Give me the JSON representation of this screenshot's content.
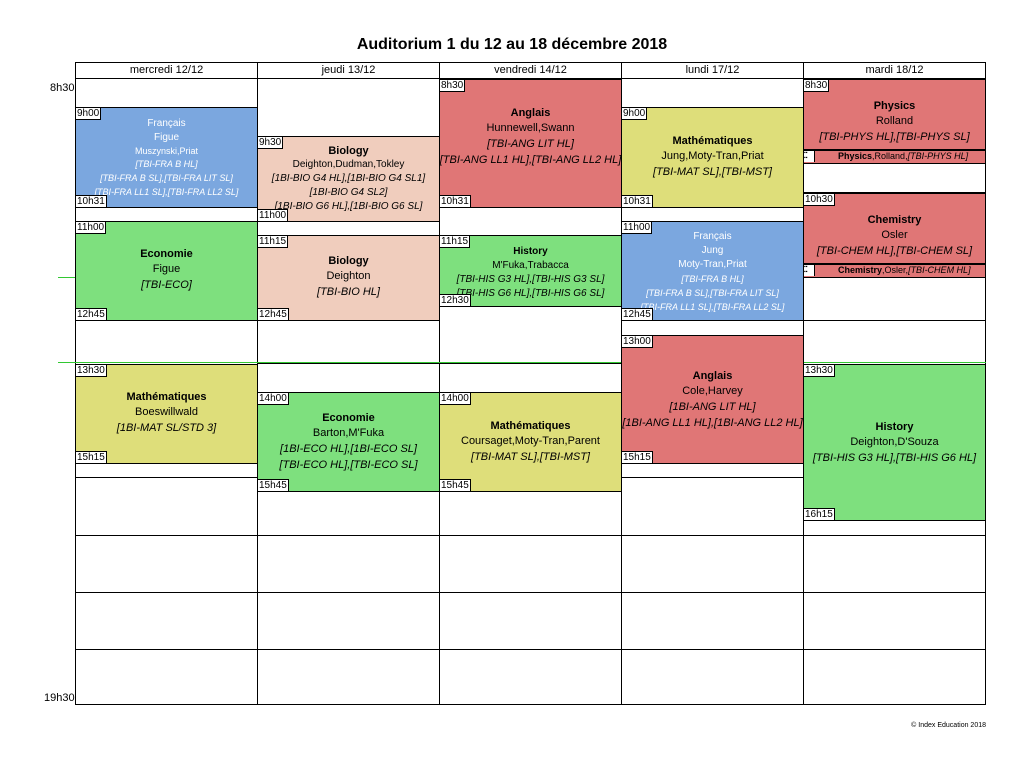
{
  "title": "Auditorium 1 du 12 au 18 décembre 2018",
  "footer": "© Index Education 2018",
  "time_axis": {
    "start": "8h30",
    "end": "19h30"
  },
  "days": [
    {
      "label": "mercredi 12/12"
    },
    {
      "label": "jeudi 13/12"
    },
    {
      "label": "vendredi 14/12"
    },
    {
      "label": "lundi 17/12"
    },
    {
      "label": "mardi 18/12"
    }
  ],
  "events": [
    {
      "day": 0,
      "start": "9h00",
      "end": "10h31",
      "subject": "Français",
      "teachers": "Figue",
      "extra": "Muszynski,Priat",
      "groups": [
        "[TBI-FRA B HL]",
        "[TBI-FRA B SL],[TBI-FRA LIT SL]",
        "[TBI-FRA LL1 SL],[TBI-FRA LL2 SL]"
      ],
      "color": "#7ba7df"
    },
    {
      "day": 0,
      "start": "11h00",
      "end": "12h45",
      "subject": "Economie",
      "teachers": "Figue",
      "extra": "",
      "groups": [
        "[TBI-ECO]"
      ],
      "color": "#7ee07e"
    },
    {
      "day": 0,
      "start": "13h30",
      "end": "15h15",
      "subject": "Mathématiques",
      "teachers": "Boeswillwald",
      "extra": "",
      "groups": [
        "[1BI-MAT SL/STD 3]"
      ],
      "color": "#dede7a"
    },
    {
      "day": 1,
      "start": "9h30",
      "end": "11h00",
      "subject": "Biology",
      "teachers": "Deighton,Dudman,Tokley",
      "extra": "",
      "groups": [
        "[1BI-BIO G4 HL],[1BI-BIO G4 SL1]",
        "[1BI-BIO G4 SL2]",
        "[1BI-BIO G6 HL],[1BI-BIO G6 SL]"
      ],
      "color": "#f0cdbd"
    },
    {
      "day": 1,
      "start": "11h15",
      "end": "12h45",
      "subject": "Biology",
      "teachers": "Deighton",
      "extra": "",
      "groups": [
        "[TBI-BIO HL]"
      ],
      "color": "#f0cdbd"
    },
    {
      "day": 1,
      "start": "14h00",
      "end": "15h45",
      "subject": "Economie",
      "teachers": "Barton,M'Fuka",
      "extra": "",
      "groups": [
        "[1BI-ECO HL],[1BI-ECO SL]",
        "[TBI-ECO HL],[TBI-ECO SL]"
      ],
      "color": "#7ee07e"
    },
    {
      "day": 2,
      "start": "8h30",
      "end": "10h31",
      "subject": "Anglais",
      "teachers": "Hunnewell,Swann",
      "extra": "",
      "groups": [
        "[TBI-ANG LIT HL]",
        "[TBI-ANG LL1 HL],[TBI-ANG LL2 HL]"
      ],
      "color": "#e07676"
    },
    {
      "day": 2,
      "start": "11h15",
      "end": "12h30",
      "subject": "History",
      "teachers": "M'Fuka,Trabacca",
      "extra": "",
      "groups": [
        "[TBI-HIS G3 HL],[TBI-HIS G3 SL]",
        "[TBI-HIS G6 HL],[TBI-HIS G6 SL]"
      ],
      "color": "#7ee07e"
    },
    {
      "day": 2,
      "start": "14h00",
      "end": "15h45",
      "subject": "Mathématiques",
      "teachers": "Coursaget,Moty-Tran,Parent",
      "extra": "",
      "groups": [
        "[TBI-MAT SL],[TBI-MST]"
      ],
      "color": "#dede7a"
    },
    {
      "day": 3,
      "start": "9h00",
      "end": "10h31",
      "subject": "Mathématiques",
      "teachers": "Jung,Moty-Tran,Priat",
      "extra": "",
      "groups": [
        "[TBI-MAT SL],[TBI-MST]"
      ],
      "color": "#dede7a"
    },
    {
      "day": 3,
      "start": "11h00",
      "end": "12h45",
      "subject": "Français",
      "teachers": "Jung",
      "extra": "Moty-Tran,Priat",
      "groups": [
        "[TBI-FRA B HL]",
        "[TBI-FRA B SL],[TBI-FRA LIT SL]",
        "[TBI-FRA LL1 SL],[TBI-FRA LL2 SL]"
      ],
      "color": "#7ba7df"
    },
    {
      "day": 3,
      "start": "13h00",
      "end": "15h15",
      "subject": "Anglais",
      "teachers": "Cole,Harvey",
      "extra": "",
      "groups": [
        "[1BI-ANG LIT HL]",
        "[1BI-ANG LL1 HL],[1BI-ANG LL2 HL]"
      ],
      "color": "#e07676"
    },
    {
      "day": 4,
      "start": "8h30",
      "end": "",
      "subject": "Physics",
      "teachers": "Rolland",
      "extra": "",
      "groups": [
        "[TBI-PHYS HL],[TBI-PHYS SL]"
      ],
      "color": "#e07676"
    },
    {
      "day": 4,
      "start": "10h30",
      "end": "",
      "subject": "Chemistry",
      "teachers": "Osler",
      "extra": "",
      "groups": [
        "[TBI-CHEM HL],[TBI-CHEM SL]"
      ],
      "color": "#e07676"
    },
    {
      "day": 4,
      "start": "13h30",
      "end": "16h15",
      "subject": "History",
      "teachers": "Deighton,D'Souza",
      "extra": "",
      "groups": [
        "[TBI-HIS G3 HL],[TBI-HIS G6 HL]"
      ],
      "color": "#7ee07e"
    }
  ],
  "mini_bars": [
    {
      "subject": "Physics",
      "teachers": "Rolland",
      "group": "[TBI-PHYS HL]"
    },
    {
      "subject": "Chemistry",
      "teachers": "Osler",
      "group": "[TBI-CHEM HL]"
    }
  ]
}
